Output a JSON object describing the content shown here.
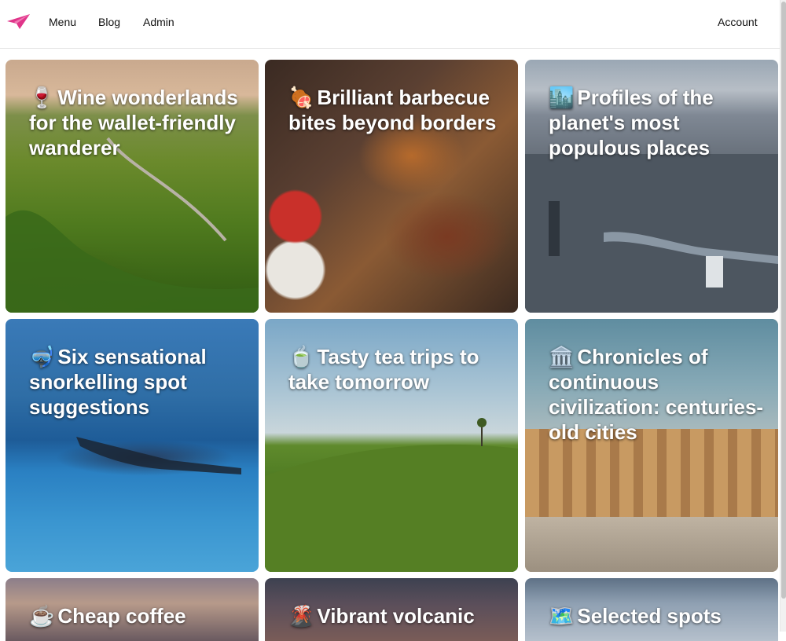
{
  "nav": {
    "links": [
      "Menu",
      "Blog",
      "Admin"
    ],
    "account": "Account",
    "logo_icon": "paper-plane-icon",
    "logo_color": "#e0358a"
  },
  "cards": [
    {
      "emoji": "🍷",
      "title": "Wine wonderlands for the wallet-friendly wanderer"
    },
    {
      "emoji": "🍖",
      "title": "Brilliant barbecue bites beyond borders"
    },
    {
      "emoji": "🏙️",
      "title": "Profiles of the planet's most populous places"
    },
    {
      "emoji": "🤿",
      "title": "Six sensational snorkelling spot suggestions"
    },
    {
      "emoji": "🍵",
      "title": "Tasty tea trips to take tomorrow"
    },
    {
      "emoji": "🏛️",
      "title": "Chronicles of continuous civilization: centuries-old cities"
    },
    {
      "emoji": "☕",
      "title": "Cheap coffee"
    },
    {
      "emoji": "🌋",
      "title": "Vibrant volcanic"
    },
    {
      "emoji": "🗺️",
      "title": "Selected spots"
    }
  ]
}
